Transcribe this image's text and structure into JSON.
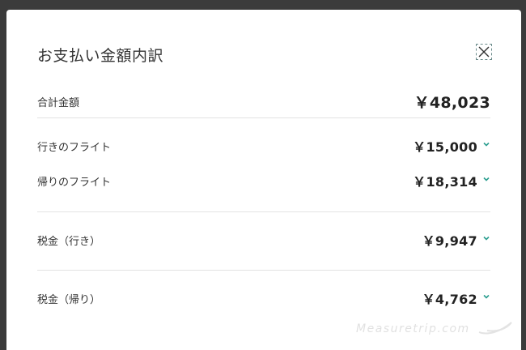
{
  "modal": {
    "title": "お支払い金額内訳",
    "close_icon": "close-icon"
  },
  "total": {
    "label": "合計金額",
    "amount": "￥48,023"
  },
  "items": [
    {
      "label": "行きのフライト",
      "amount": "￥15,000",
      "icon": "chevron-down-icon"
    },
    {
      "label": "帰りのフライト",
      "amount": "￥18,314",
      "icon": "chevron-down-icon"
    },
    {
      "label": "税金（行き）",
      "amount": "￥9,947",
      "icon": "chevron-down-icon"
    },
    {
      "label": "税金（帰り）",
      "amount": "￥4,762",
      "icon": "chevron-down-icon"
    }
  ],
  "watermark": "Measuretrip.com",
  "colors": {
    "backdrop": "#3b3b3b",
    "chevron": "#2a9d8f",
    "divider": "#e3e3e3"
  }
}
